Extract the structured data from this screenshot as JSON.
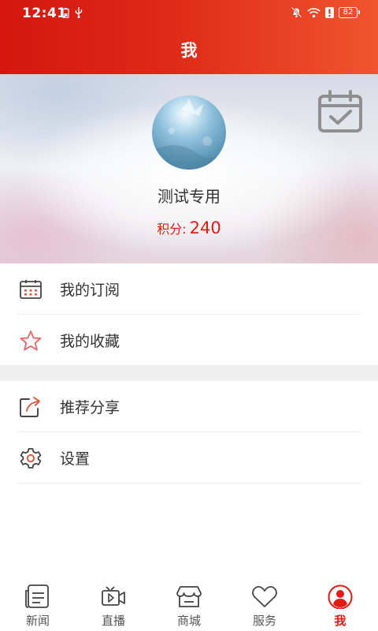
{
  "status_bar": {
    "time": "12:41",
    "battery": "82"
  },
  "header": {
    "title": "我"
  },
  "profile": {
    "username": "测试专用",
    "points_label": "积分:",
    "points_value": "240"
  },
  "menu": {
    "items": [
      {
        "label": "我的订阅",
        "icon": "calendar-icon"
      },
      {
        "label": "我的收藏",
        "icon": "star-icon"
      },
      {
        "label": "推荐分享",
        "icon": "share-icon"
      },
      {
        "label": "设置",
        "icon": "gear-icon"
      }
    ]
  },
  "tabbar": {
    "tabs": [
      {
        "label": "新闻",
        "icon": "news-icon"
      },
      {
        "label": "直播",
        "icon": "video-icon"
      },
      {
        "label": "商城",
        "icon": "store-icon"
      },
      {
        "label": "服务",
        "icon": "heart-icon"
      },
      {
        "label": "我",
        "icon": "user-icon"
      }
    ],
    "active": "我"
  },
  "colors": {
    "brand": "#e01c14",
    "header_start": "#d4160f",
    "header_end": "#f0552e"
  }
}
